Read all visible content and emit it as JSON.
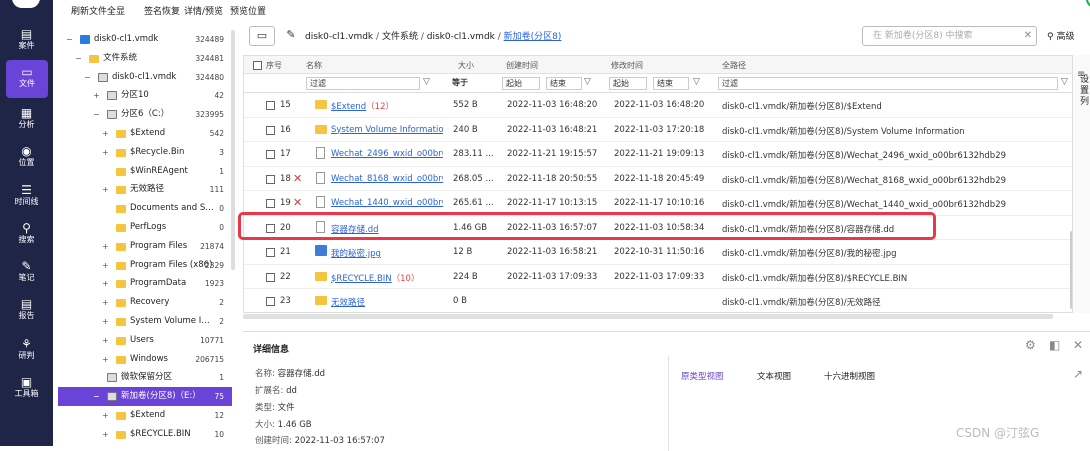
{
  "sidebar": [
    {
      "icon": "case-icon",
      "glyph": "▤",
      "label": "案件"
    },
    {
      "icon": "file-icon",
      "glyph": "▭",
      "label": "文件"
    },
    {
      "icon": "analysis-icon",
      "glyph": "▦",
      "label": "分析"
    },
    {
      "icon": "location-icon",
      "glyph": "◉",
      "label": "位置"
    },
    {
      "icon": "timeline-icon",
      "glyph": "☰",
      "label": "时间线"
    },
    {
      "icon": "search-icon",
      "glyph": "⚲",
      "label": "搜索"
    },
    {
      "icon": "note-icon",
      "glyph": "✎",
      "label": "笔记"
    },
    {
      "icon": "report-icon",
      "glyph": "▤",
      "label": "报告"
    },
    {
      "icon": "research-icon",
      "glyph": "⚘",
      "label": "研判"
    },
    {
      "icon": "toolbox-icon",
      "glyph": "▣",
      "label": "工具箱"
    }
  ],
  "menubar": {
    "refresh": "刷新",
    "file_overview": "文件全显",
    "sign_restore": "签名恢复",
    "detail_preview": "详情/预览",
    "preview_pos": "预览位置"
  },
  "tree": [
    {
      "lv": 0,
      "tg": "−",
      "ic": "win",
      "label": "disk0-cl1.vmdk",
      "count": "324489"
    },
    {
      "lv": 1,
      "tg": "−",
      "ic": "folder",
      "label": "文件系统",
      "count": "324481"
    },
    {
      "lv": 2,
      "tg": "−",
      "ic": "disk",
      "label": "disk0-cl1.vmdk",
      "count": "324480"
    },
    {
      "lv": 3,
      "tg": "+",
      "ic": "disk",
      "label": "分区10",
      "count": "42"
    },
    {
      "lv": 3,
      "tg": "−",
      "ic": "disk",
      "label": "分区6（C:）",
      "count": "323995"
    },
    {
      "lv": 4,
      "tg": "+",
      "ic": "folder",
      "label": "$Extend",
      "count": "542"
    },
    {
      "lv": 4,
      "tg": "+",
      "ic": "folder",
      "label": "$Recycle.Bin",
      "count": "3"
    },
    {
      "lv": 4,
      "tg": "",
      "ic": "folder",
      "label": "$WinREAgent",
      "count": "1"
    },
    {
      "lv": 4,
      "tg": "+",
      "ic": "folder",
      "label": "无效路径",
      "count": "111"
    },
    {
      "lv": 4,
      "tg": "",
      "ic": "folder",
      "label": "Documents and Setti...",
      "count": "0"
    },
    {
      "lv": 4,
      "tg": "",
      "ic": "folder",
      "label": "PerfLogs",
      "count": "0"
    },
    {
      "lv": 4,
      "tg": "+",
      "ic": "folder",
      "label": "Program Files",
      "count": "21874"
    },
    {
      "lv": 4,
      "tg": "+",
      "ic": "folder",
      "label": "Program Files (x86)",
      "count": "2329"
    },
    {
      "lv": 4,
      "tg": "+",
      "ic": "folder",
      "label": "ProgramData",
      "count": "1923"
    },
    {
      "lv": 4,
      "tg": "+",
      "ic": "folder",
      "label": "Recovery",
      "count": "2"
    },
    {
      "lv": 4,
      "tg": "+",
      "ic": "folder",
      "label": "System Volume Infor...",
      "count": "2"
    },
    {
      "lv": 4,
      "tg": "+",
      "ic": "folder",
      "label": "Users",
      "count": "10771"
    },
    {
      "lv": 4,
      "tg": "+",
      "ic": "folder",
      "label": "Windows",
      "count": "206715"
    },
    {
      "lv": 3,
      "tg": "",
      "ic": "disk",
      "label": "微软保留分区",
      "count": "1"
    },
    {
      "lv": 3,
      "tg": "−",
      "ic": "disk",
      "label": "新加卷(分区8)（E:）",
      "count": "75",
      "sel": true
    },
    {
      "lv": 4,
      "tg": "+",
      "ic": "folder",
      "label": "$Extend",
      "count": "12"
    },
    {
      "lv": 4,
      "tg": "+",
      "ic": "folder",
      "label": "$RECYCLE.BIN",
      "count": "10"
    }
  ],
  "path": {
    "seg1": "disk0-cl1.vmdk",
    "seg2": "文件系统",
    "seg3": "disk0-cl1.vmdk",
    "seg4": "新加卷(分区8)",
    "search_placeholder": "在 新加卷(分区8) 中搜索",
    "advanced": "高级"
  },
  "table": {
    "headers": {
      "seq": "序号",
      "name": "名称",
      "size": "大小",
      "created": "创建时间",
      "modified": "修改时间",
      "fullpath": "全路径"
    },
    "filters": {
      "name": "过滤",
      "size": "等于",
      "c_start": "起始",
      "c_end": "结束",
      "m_start": "起始",
      "m_end": "结束",
      "path": "过滤"
    },
    "rows": [
      {
        "seq": "15",
        "x": false,
        "icon": "folder",
        "name": "$Extend",
        "cnt": "（12）",
        "size": "552 B",
        "created": "2022-11-03 16:48:20",
        "modified": "2022-11-03 16:48:20",
        "path": "disk0-cl1.vmdk/新加卷(分区8)/$Extend"
      },
      {
        "seq": "16",
        "x": false,
        "icon": "folder",
        "name": "System Volume Informatio",
        "cnt": "",
        "size": "240 B",
        "created": "2022-11-03 16:48:21",
        "modified": "2022-11-03 17:20:18",
        "path": "disk0-cl1.vmdk/新加卷(分区8)/System Volume Information"
      },
      {
        "seq": "17",
        "x": false,
        "icon": "doc",
        "name": "Wechat_2496_wxid_o00br6",
        "cnt": "",
        "size": "283.11 ...",
        "created": "2022-11-21 19:15:57",
        "modified": "2022-11-21 19:09:13",
        "path": "disk0-cl1.vmdk/新加卷(分区8)/Wechat_2496_wxid_o00br6132hdb29"
      },
      {
        "seq": "18",
        "x": true,
        "icon": "doc",
        "name": "Wechat_8168_wxid_o00br6",
        "cnt": "",
        "size": "268.05 ...",
        "created": "2022-11-18 20:50:55",
        "modified": "2022-11-18 20:45:49",
        "path": "disk0-cl1.vmdk/新加卷(分区8)/Wechat_8168_wxid_o00br6132hdb29"
      },
      {
        "seq": "19",
        "x": true,
        "icon": "doc",
        "name": "Wechat_1440_wxid_o00br6",
        "cnt": "",
        "size": "265.61 ...",
        "created": "2022-11-17 10:13:15",
        "modified": "2022-11-17 10:10:16",
        "path": "disk0-cl1.vmdk/新加卷(分区8)/Wechat_1440_wxid_o00br6132hdb29"
      },
      {
        "seq": "20",
        "x": false,
        "icon": "doc",
        "name": "容器存储.dd",
        "cnt": "",
        "size": "1.46 GB",
        "created": "2022-11-03 16:57:07",
        "modified": "2022-11-03 10:58:34",
        "path": "disk0-cl1.vmdk/新加卷(分区8)/容器存储.dd"
      },
      {
        "seq": "21",
        "x": false,
        "icon": "img",
        "name": "我的秘密.jpg",
        "cnt": "",
        "size": "12 B",
        "created": "2022-11-03 16:58:21",
        "modified": "2022-10-31 11:50:16",
        "path": "disk0-cl1.vmdk/新加卷(分区8)/我的秘密.jpg"
      },
      {
        "seq": "22",
        "x": false,
        "icon": "folder",
        "name": "$RECYCLE.BIN",
        "cnt": "（10）",
        "size": "224 B",
        "created": "2022-11-03 17:09:33",
        "modified": "2022-11-03 17:09:33",
        "path": "disk0-cl1.vmdk/新加卷(分区8)/$RECYCLE.BIN"
      },
      {
        "seq": "23",
        "x": false,
        "icon": "folder",
        "name": "无效路径",
        "cnt": "",
        "size": "0 B",
        "created": "",
        "modified": "",
        "path": "disk0-cl1.vmdk/新加卷(分区8)/无效路径"
      }
    ],
    "side_label": "设置列"
  },
  "detail": {
    "title": "详细信息",
    "name_k": "名称:",
    "name_v": "容器存储.dd",
    "ext_k": "扩展名:",
    "ext_v": "dd",
    "type_k": "类型:",
    "type_v": "文件",
    "size_k": "大小:",
    "size_v": "1.46 GB",
    "ctime_k": "创建时间:",
    "ctime_v": "2022-11-03 16:57:07",
    "tab_raw": "原类型视图",
    "tab_text": "文本视图",
    "tab_hex": "十六进制视图"
  },
  "watermark": "CSDN @汀弦G"
}
